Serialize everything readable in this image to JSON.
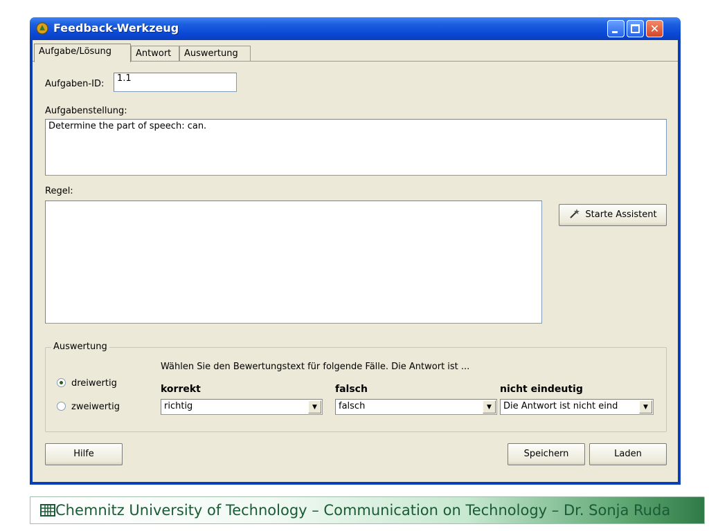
{
  "window": {
    "title": "Feedback-Werkzeug"
  },
  "tabs": [
    {
      "label": "Aufgabe/Lösung",
      "active": true
    },
    {
      "label": "Antwort",
      "active": false
    },
    {
      "label": "Auswertung",
      "active": false
    }
  ],
  "form": {
    "task_id_label": "Aufgaben-ID:",
    "task_id_value": "1.1",
    "task_label": "Aufgabenstellung:",
    "task_value": "Determine the part of speech: can.",
    "rule_label": "Regel:",
    "rule_value": "",
    "assistant_button": "Starte Assistent"
  },
  "evaluation": {
    "legend": "Auswertung",
    "instruction": "Wählen Sie den Bewertungstext für folgende Fälle. Die Antwort ist ...",
    "modes": [
      {
        "label": "dreiwertig",
        "selected": true
      },
      {
        "label": "zweiwertig",
        "selected": false
      }
    ],
    "columns": [
      {
        "heading": "korrekt",
        "value": "richtig"
      },
      {
        "heading": "falsch",
        "value": "falsch"
      },
      {
        "heading": "nicht eindeutig",
        "value": "Die Antwort ist nicht eind"
      }
    ]
  },
  "buttons": {
    "help": "Hilfe",
    "save": "Speichern",
    "load": "Laden"
  },
  "footer": {
    "text": "Chemnitz University of Technology – Communication on Technology – Dr. Sonja Ruda"
  },
  "colors": {
    "titlebar": "#0b49d6",
    "dialog_bg": "#ece9d8",
    "banner_text": "#1a5a34"
  }
}
